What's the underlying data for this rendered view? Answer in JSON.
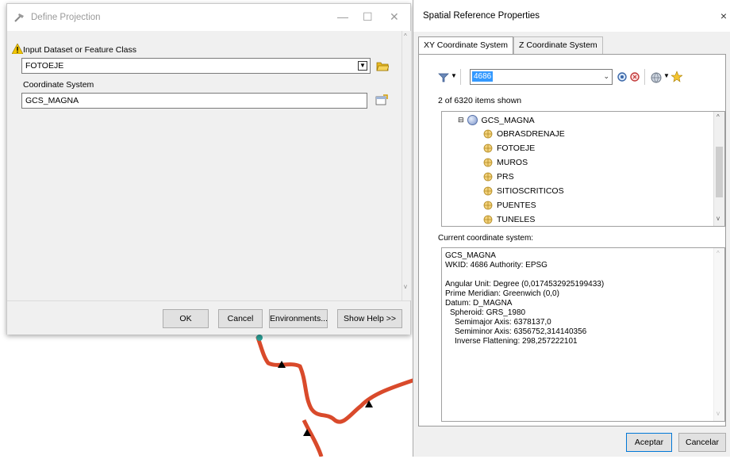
{
  "define_projection": {
    "title": "Define Projection",
    "input_label": "Input Dataset or Feature Class",
    "input_value": "FOTOEJE",
    "cs_label": "Coordinate System",
    "cs_value": "GCS_MAGNA",
    "buttons": {
      "ok": "OK",
      "cancel": "Cancel",
      "environments": "Environments...",
      "show_help": "Show Help >>"
    }
  },
  "srp": {
    "title": "Spatial Reference Properties",
    "close_glyph": "×",
    "tabs": [
      "XY Coordinate System",
      "Z Coordinate System"
    ],
    "search_value": "4686",
    "items_shown": "2 of 6320 items shown",
    "tree": {
      "root": "GCS_MAGNA",
      "children": [
        "OBRASDRENAJE",
        "FOTOEJE",
        "MUROS",
        "PRS",
        "SITIOSCRITICOS",
        "PUENTES",
        "TUNELES"
      ]
    },
    "current_label": "Current coordinate system:",
    "details": [
      "GCS_MAGNA",
      "WKID: 4686 Authority: EPSG",
      "",
      "Angular Unit: Degree (0,0174532925199433)",
      "Prime Meridian: Greenwich (0,0)",
      "Datum: D_MAGNA",
      "  Spheroid: GRS_1980",
      "    Semimajor Axis: 6378137,0",
      "    Semiminor Axis: 6356752,314140356",
      "    Inverse Flattening: 298,257222101"
    ],
    "buttons": {
      "accept": "Aceptar",
      "cancel": "Cancelar"
    }
  },
  "colors": {
    "route": "#d94a2b",
    "selection": "#3399ff",
    "warning": "#f2c500"
  }
}
